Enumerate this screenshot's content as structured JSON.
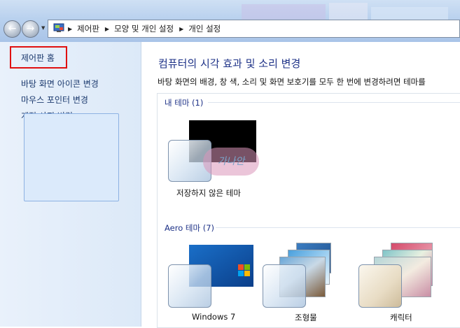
{
  "address_bar": {
    "crumbs": [
      "제어판",
      "모양 및 개인 설정",
      "개인 설정"
    ]
  },
  "sidebar": {
    "items": [
      {
        "label": "제어판 홈"
      },
      {
        "label": "바탕 화면 아이콘 변경"
      },
      {
        "label": "마우스 포인터 변경"
      },
      {
        "label": "계정 사진 변경"
      }
    ]
  },
  "main": {
    "title": "컴퓨터의 시각 효과 및 소리 변경",
    "description": "바탕 화면의 배경, 창 색, 소리 및 화면 보호기를 모두 한 번에 변경하려면 테마를",
    "groups": [
      {
        "label": "내 테마 (1)",
        "themes": [
          {
            "label": "저장하지 않은 테마"
          }
        ]
      },
      {
        "label": "Aero 테마 (7)",
        "themes": [
          {
            "label": "Windows 7"
          },
          {
            "label": "조형물"
          },
          {
            "label": "캐릭터"
          }
        ]
      }
    ]
  },
  "watermark": "가나안",
  "colors": {
    "link": "#1c3a6e",
    "title": "#1e3287",
    "highlight_box": "#e01010"
  }
}
